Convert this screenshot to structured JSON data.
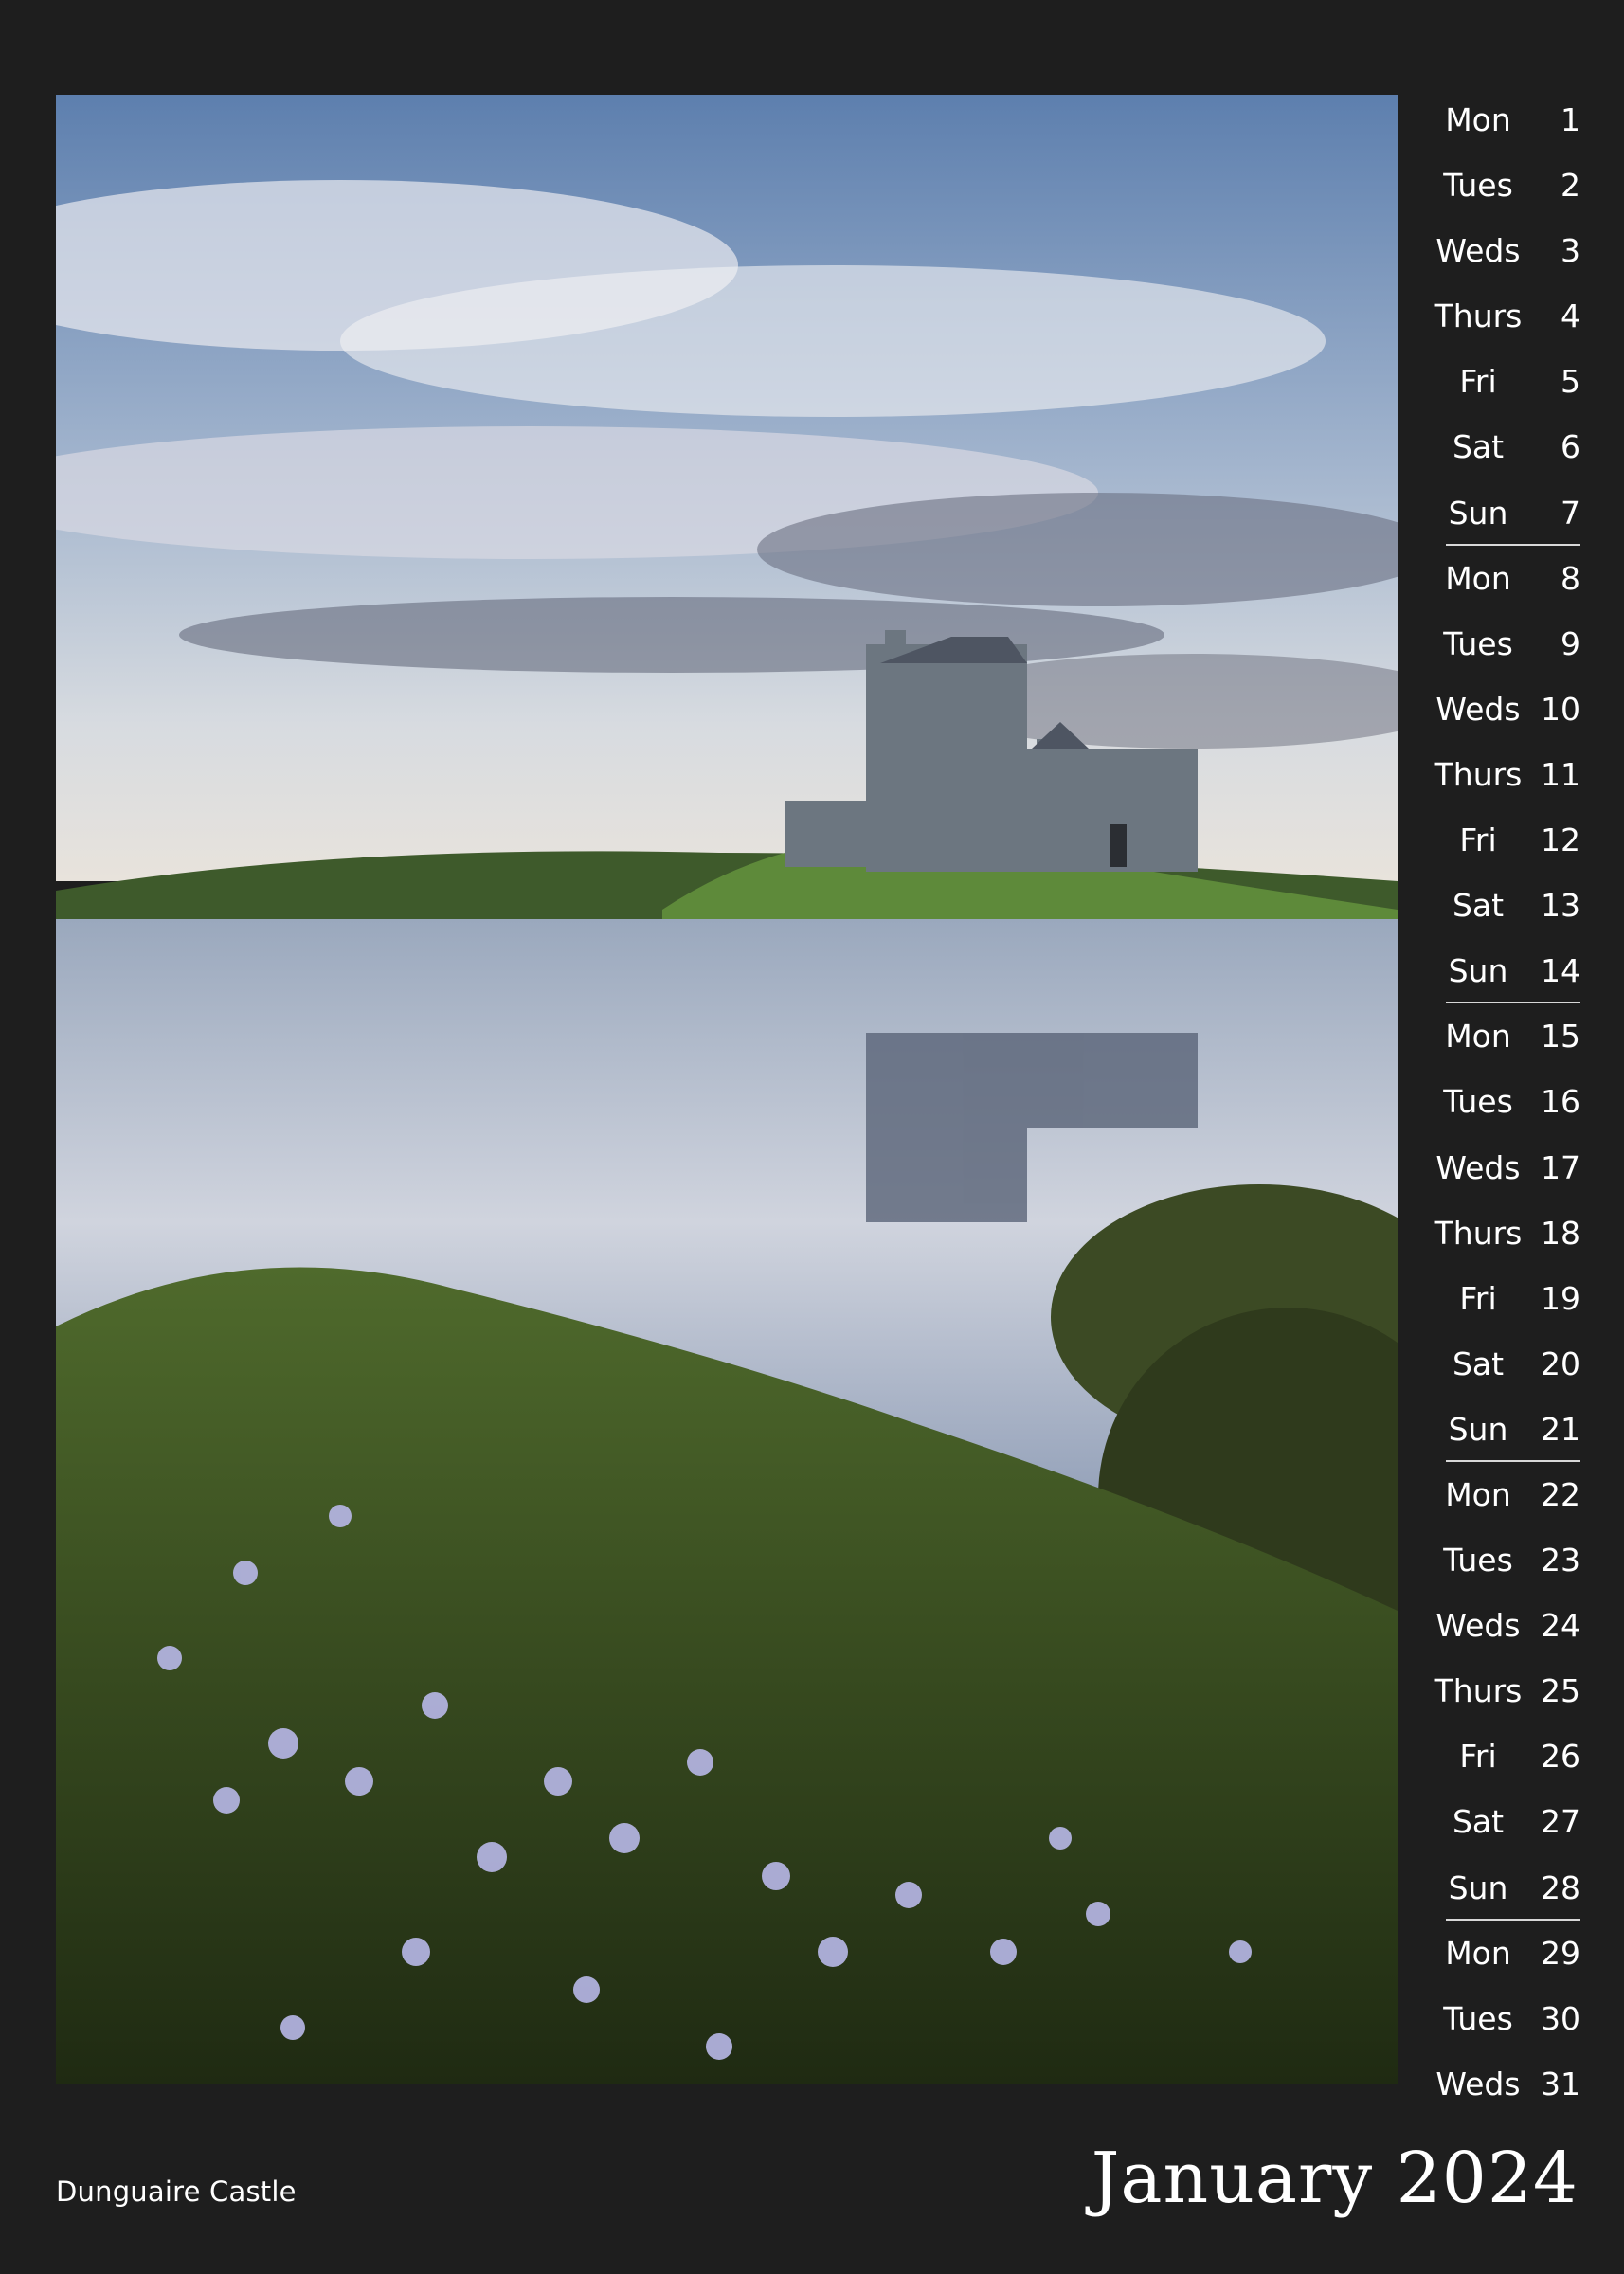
{
  "calendar": {
    "month_title": "January 2024",
    "photo_caption": "Dunguaire Castle",
    "days": [
      {
        "weekday": "Mon",
        "date": "1"
      },
      {
        "weekday": "Tues",
        "date": "2"
      },
      {
        "weekday": "Weds",
        "date": "3"
      },
      {
        "weekday": "Thurs",
        "date": "4"
      },
      {
        "weekday": "Fri",
        "date": "5"
      },
      {
        "weekday": "Sat",
        "date": "6"
      },
      {
        "weekday": "Sun",
        "date": "7"
      },
      {
        "weekday": "Mon",
        "date": "8"
      },
      {
        "weekday": "Tues",
        "date": "9"
      },
      {
        "weekday": "Weds",
        "date": "10"
      },
      {
        "weekday": "Thurs",
        "date": "11"
      },
      {
        "weekday": "Fri",
        "date": "12"
      },
      {
        "weekday": "Sat",
        "date": "13"
      },
      {
        "weekday": "Sun",
        "date": "14"
      },
      {
        "weekday": "Mon",
        "date": "15"
      },
      {
        "weekday": "Tues",
        "date": "16"
      },
      {
        "weekday": "Weds",
        "date": "17"
      },
      {
        "weekday": "Thurs",
        "date": "18"
      },
      {
        "weekday": "Fri",
        "date": "19"
      },
      {
        "weekday": "Sat",
        "date": "20"
      },
      {
        "weekday": "Sun",
        "date": "21"
      },
      {
        "weekday": "Mon",
        "date": "22"
      },
      {
        "weekday": "Tues",
        "date": "23"
      },
      {
        "weekday": "Weds",
        "date": "24"
      },
      {
        "weekday": "Thurs",
        "date": "25"
      },
      {
        "weekday": "Fri",
        "date": "26"
      },
      {
        "weekday": "Sat",
        "date": "27"
      },
      {
        "weekday": "Sun",
        "date": "28"
      },
      {
        "weekday": "Mon",
        "date": "29"
      },
      {
        "weekday": "Tues",
        "date": "30"
      },
      {
        "weekday": "Weds",
        "date": "31"
      }
    ]
  },
  "colors": {
    "background": "#1e1e1e",
    "text": "#ffffff",
    "week_divider": "#d8d8d8"
  }
}
